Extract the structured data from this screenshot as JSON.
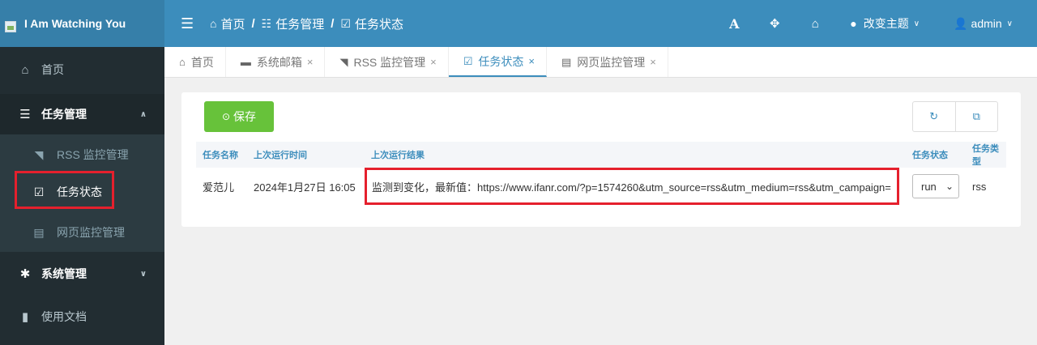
{
  "app": {
    "title": "I Am Watching You"
  },
  "breadcrumb": [
    {
      "label": "首页",
      "icon": "home-icon"
    },
    {
      "label": "任务管理",
      "icon": "list-icon"
    },
    {
      "label": "任务状态",
      "icon": "calendar-check-icon"
    }
  ],
  "topbar": {
    "font_icon": "A",
    "theme_label": "改变主题",
    "user_label": "admin"
  },
  "sidebar": {
    "items": [
      {
        "label": "首页",
        "icon": "home-icon"
      },
      {
        "label": "任务管理",
        "icon": "tasks-icon"
      },
      {
        "label": "系统管理",
        "icon": "gear-icon"
      },
      {
        "label": "使用文档",
        "icon": "file-icon"
      }
    ],
    "sub_items": [
      {
        "label": "RSS 监控管理",
        "icon": "rss-icon"
      },
      {
        "label": "任务状态",
        "icon": "calendar-check-icon"
      },
      {
        "label": "网页监控管理",
        "icon": "file-code-icon"
      }
    ]
  },
  "tabs": [
    {
      "label": "首页",
      "closable": false
    },
    {
      "label": "系统邮箱",
      "closable": true
    },
    {
      "label": "RSS 监控管理",
      "closable": true
    },
    {
      "label": "任务状态",
      "closable": true,
      "active": true
    },
    {
      "label": "网页监控管理",
      "closable": true
    }
  ],
  "toolbar": {
    "save_label": "保存"
  },
  "table": {
    "headers": [
      "任务名称",
      "上次运行时间",
      "上次运行结果",
      "任务状态",
      "任务类型"
    ],
    "rows": [
      {
        "name": "爱范儿",
        "last_run": "2024年1月27日 16:05",
        "result": "监测到变化，最新值：https://www.ifanr.com/?p=1574260&utm_source=rss&utm_medium=rss&utm_campaign=",
        "state": "run",
        "type": "rss"
      }
    ]
  },
  "colors": {
    "primary": "#3c8dbc",
    "success": "#67c23a",
    "sidebar": "#222d32",
    "highlight": "#e5202d"
  }
}
